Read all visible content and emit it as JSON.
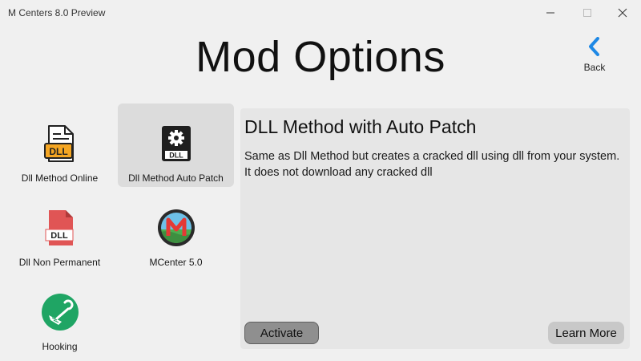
{
  "window": {
    "title": "M Centers 8.0 Preview",
    "controls": [
      "minimize-icon",
      "maximize-icon",
      "close-icon"
    ]
  },
  "header": {
    "title": "Mod Options",
    "back_label": "Back",
    "back_icon": "chevron-left-icon",
    "accent": "#1e88e5"
  },
  "methods": [
    {
      "label": "Dll Method Online",
      "icon": "dll-file-icon",
      "selected": false
    },
    {
      "label": "Dll Method Auto Patch",
      "icon": "dll-gear-icon",
      "selected": true
    },
    {
      "label": "Dll Non Permanent",
      "icon": "dll-red-file-icon",
      "selected": false
    },
    {
      "label": "MCenter 5.0",
      "icon": "mcenter-logo-icon",
      "selected": false
    },
    {
      "label": "Hooking",
      "icon": "hook-icon",
      "selected": false
    }
  ],
  "detail": {
    "title": "DLL Method with Auto Patch",
    "description": "Same as Dll Method but creates a cracked dll using dll from your system. It does not download any cracked dll",
    "activate_label": "Activate",
    "learn_more_label": "Learn More"
  },
  "colors": {
    "background": "#f0f0f0",
    "panel": "#e6e6e6",
    "selected_tile": "#dcdcdc",
    "activate_button": "#8f8f8f",
    "learn_more_button": "#c8c8c8"
  }
}
